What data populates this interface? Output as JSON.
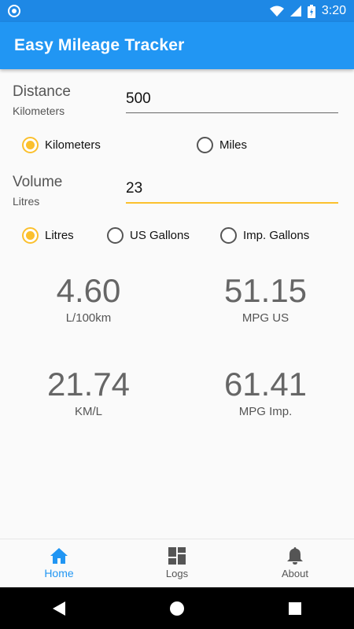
{
  "status_bar": {
    "time": "3:20"
  },
  "app": {
    "title": "Easy Mileage Tracker"
  },
  "distance": {
    "label": "Distance",
    "unit_label": "Kilometers",
    "value": "500",
    "options": [
      {
        "label": "Kilometers",
        "selected": true
      },
      {
        "label": "Miles",
        "selected": false
      }
    ]
  },
  "volume": {
    "label": "Volume",
    "unit_label": "Litres",
    "value": "23",
    "options": [
      {
        "label": "Litres",
        "selected": true
      },
      {
        "label": "US Gallons",
        "selected": false
      },
      {
        "label": "Imp. Gallons",
        "selected": false
      }
    ]
  },
  "results": [
    {
      "value": "4.60",
      "unit": "L/100km"
    },
    {
      "value": "51.15",
      "unit": "MPG US"
    },
    {
      "value": "21.74",
      "unit": "KM/L"
    },
    {
      "value": "61.41",
      "unit": "MPG Imp."
    }
  ],
  "bottom_nav": [
    {
      "label": "Home",
      "icon": "home-icon",
      "active": true
    },
    {
      "label": "Logs",
      "icon": "logs-icon",
      "active": false
    },
    {
      "label": "About",
      "icon": "bell-icon",
      "active": false
    }
  ],
  "colors": {
    "primary": "#2196f3",
    "status_bar": "#1e88e5",
    "accent": "#fbc02d"
  }
}
